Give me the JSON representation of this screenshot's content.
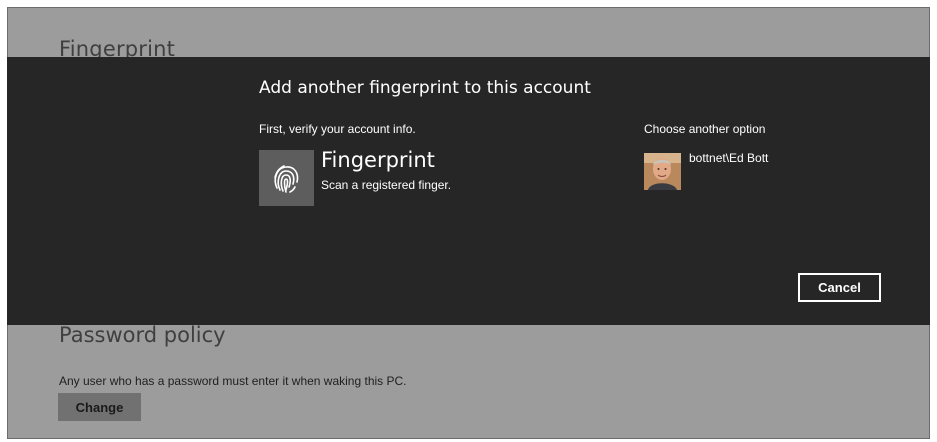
{
  "background": {
    "section_title": "Fingerprint",
    "password_policy": {
      "title": "Password policy",
      "description": "Any user who has a password must enter it when waking this PC.",
      "change_label": "Change"
    }
  },
  "dialog": {
    "title": "Add another fingerprint to this account",
    "verify_prompt": "First, verify your account info.",
    "method": {
      "name": "Fingerprint",
      "description": "Scan a registered finger.",
      "icon": "fingerprint-icon"
    },
    "other_options": {
      "title": "Choose another option",
      "user": "bottnet\\Ed Bott",
      "icon": "user-avatar"
    },
    "cancel_label": "Cancel"
  },
  "colors": {
    "overlay": "#9c9c9c",
    "dialog": "#262626",
    "tile": "#5d5d5d",
    "text_on_dark": "#ffffff"
  }
}
